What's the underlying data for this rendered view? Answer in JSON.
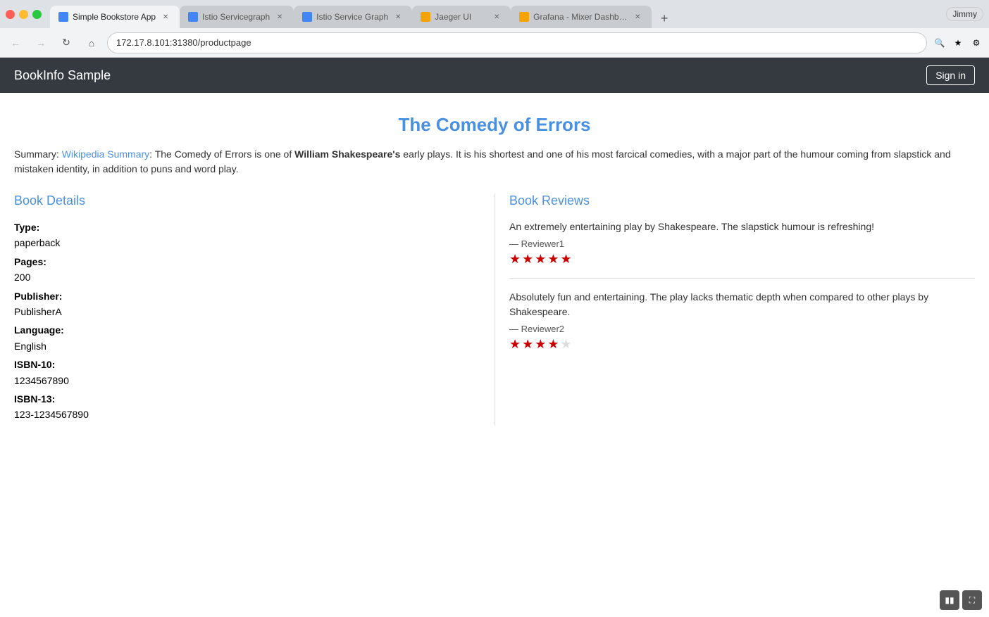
{
  "browser": {
    "tabs": [
      {
        "id": "tab1",
        "label": "Simple Bookstore App",
        "favicon": "blue",
        "active": true
      },
      {
        "id": "tab2",
        "label": "Istio Servicegraph",
        "favicon": "blue",
        "active": false
      },
      {
        "id": "tab3",
        "label": "Istio Service Graph",
        "favicon": "blue",
        "active": false
      },
      {
        "id": "tab4",
        "label": "Jaeger UI",
        "favicon": "orange",
        "active": false
      },
      {
        "id": "tab5",
        "label": "Grafana - Mixer Dashboard",
        "favicon": "orange",
        "active": false
      }
    ],
    "url": "172.17.8.101:31380/productpage",
    "user": "Jimmy"
  },
  "site": {
    "brand": "BookInfo Sample",
    "signin_label": "Sign in"
  },
  "book": {
    "title": "The Comedy of Errors",
    "summary_prefix": "Summary: ",
    "wikipedia_link": "Wikipedia Summary",
    "summary_text": ": The Comedy of Errors is one of ",
    "summary_author": "William Shakespeare's",
    "summary_rest": " early plays. It is his shortest and one of his most farcical comedies, with a major part of the humour coming from slapstick and mistaken identity, in addition to puns and word play.",
    "details_heading": "Book Details",
    "reviews_heading": "Book Reviews",
    "details": {
      "type_label": "Type:",
      "type_value": "paperback",
      "pages_label": "Pages:",
      "pages_value": "200",
      "publisher_label": "Publisher:",
      "publisher_value": "PublisherA",
      "language_label": "Language:",
      "language_value": "English",
      "isbn10_label": "ISBN-10:",
      "isbn10_value": "1234567890",
      "isbn13_label": "ISBN-13:",
      "isbn13_value": "123-1234567890"
    },
    "reviews": [
      {
        "text": "An extremely entertaining play by Shakespeare. The slapstick humour is refreshing!",
        "reviewer": "— Reviewer1",
        "stars": 5
      },
      {
        "text": "Absolutely fun and entertaining. The play lacks thematic depth when compared to other plays by Shakespeare.",
        "reviewer": "— Reviewer2",
        "stars": 4
      }
    ]
  }
}
